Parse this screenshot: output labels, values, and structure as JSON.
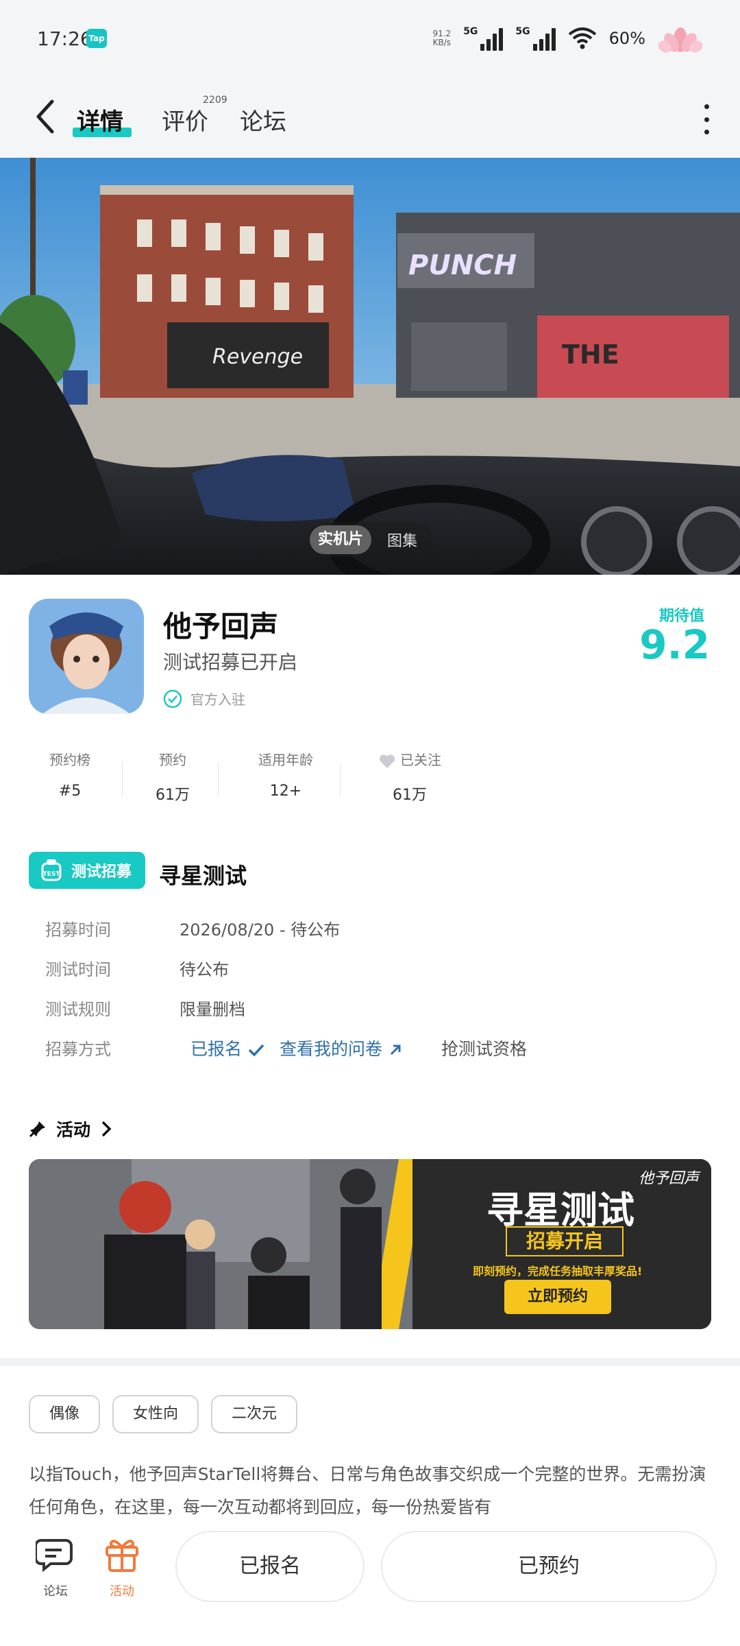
{
  "status_bar": {
    "time": "17:26",
    "tap_badge": "Tap",
    "net_speed_value": "91.2",
    "net_speed_unit": "KB/s",
    "sim1": "5G",
    "sim2": "5G",
    "battery": "60%"
  },
  "header": {
    "tabs": [
      {
        "label": "详情"
      },
      {
        "label": "评价"
      },
      {
        "label": "论坛"
      }
    ],
    "review_count": "2209"
  },
  "hero": {
    "toggle_video": "实机片",
    "toggle_images": "图集"
  },
  "game": {
    "name": "他予回声",
    "subtitle": "测试招募已开启",
    "official_label": "官方入驻",
    "score_label": "期待值",
    "score": "9.2"
  },
  "stats": [
    {
      "key": "预约榜",
      "value": "#5"
    },
    {
      "key": "预约",
      "value": "61万"
    },
    {
      "key": "适用年龄",
      "value": "12+"
    },
    {
      "key": "已关注",
      "value": "61万"
    }
  ],
  "test": {
    "badge": "测试招募",
    "title": "寻星测试",
    "rows": [
      {
        "label": "招募时间",
        "value": "2026/08/20 - 待公布"
      },
      {
        "label": "测试时间",
        "value": "待公布"
      },
      {
        "label": "测试规则",
        "value": "限量删档"
      },
      {
        "label": "招募方式",
        "value": ""
      }
    ],
    "signed_up": "已报名",
    "questionnaire": "查看我的问卷",
    "grab": "抢测试资格"
  },
  "activity": {
    "heading": "活动",
    "banner": {
      "brand": "他予回声",
      "title": "寻星测试",
      "sub": "招募开启",
      "note": "即刻预约，完成任务抽取丰厚奖品!",
      "button": "立即预约"
    }
  },
  "tags": [
    "偶像",
    "女性向",
    "二次元"
  ],
  "description": "以指Touch，他予回声StarTell将舞台、日常与角色故事交织成一个完整的世界。无需扮演任何角色，在这里，每一次互动都将到回应，每一份热爱皆有",
  "bottom_bar": {
    "forum": "论坛",
    "activity": "活动",
    "signed_up_btn": "已报名",
    "reserved_btn": "已预约"
  },
  "colors": {
    "accent": "#19c9c3",
    "activity_orange": "#f07a3a",
    "link_blue": "#2f6fa8"
  }
}
